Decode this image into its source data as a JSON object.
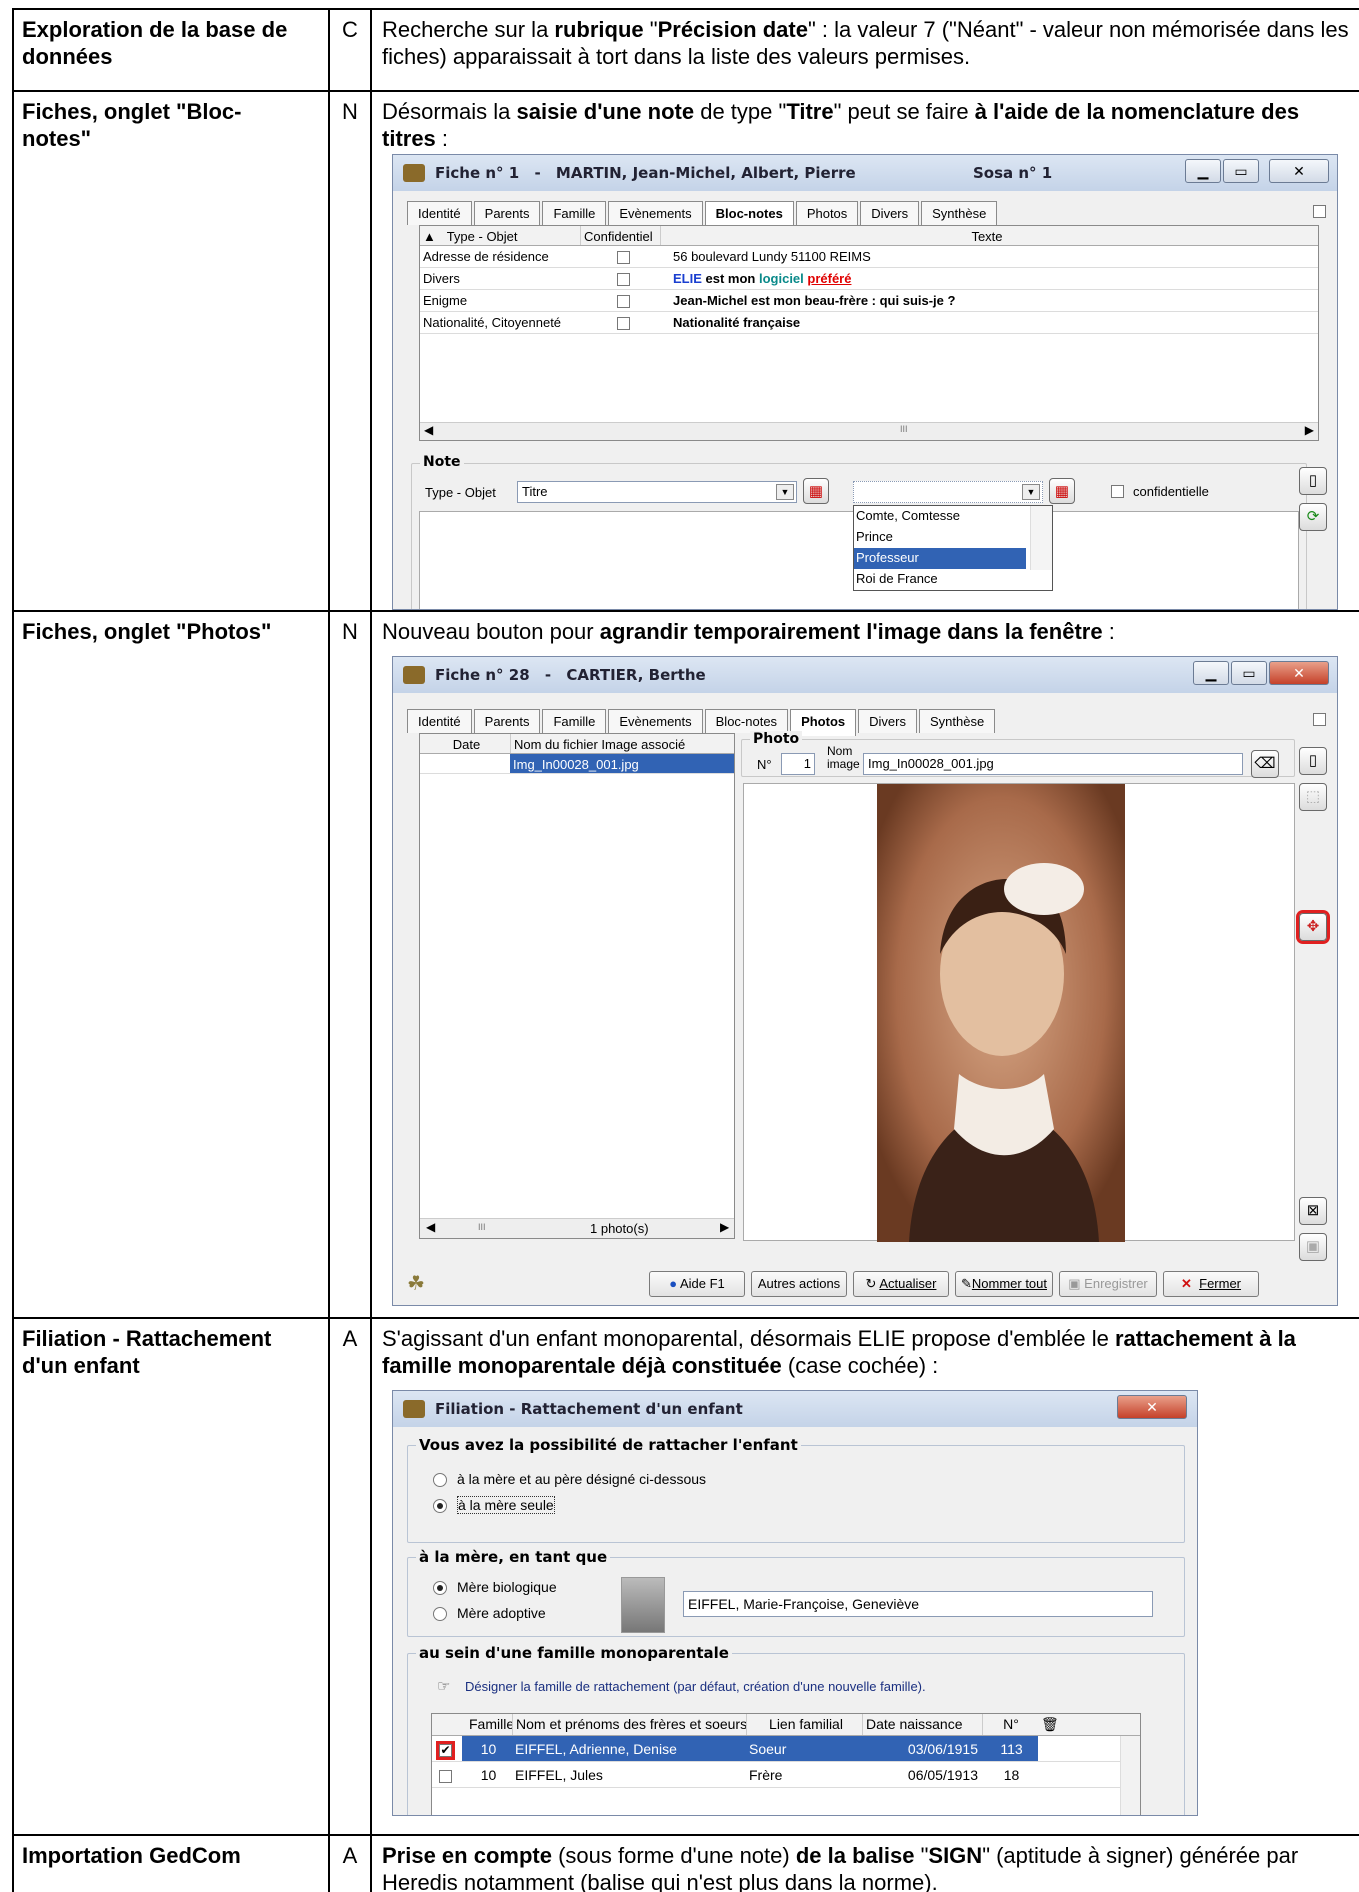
{
  "rows": [
    {
      "section": "Exploration de la base de données",
      "flag": "C",
      "text_parts": [
        {
          "t": "Recherche sur la ",
          "b": false
        },
        {
          "t": "rubrique",
          "b": true
        },
        {
          "t": " \"",
          "b": false
        },
        {
          "t": "Précision date",
          "b": true
        },
        {
          "t": "\" : la valeur 7 (\"Néant\" - valeur non mémorisée dans les fiches) apparaissait à tort dans la liste des valeurs permises.",
          "b": false
        }
      ]
    },
    {
      "section": "Fiches, onglet \"Bloc-notes\"",
      "flag": "N",
      "text_parts": [
        {
          "t": "Désormais la ",
          "b": false
        },
        {
          "t": "saisie d'une note",
          "b": true
        },
        {
          "t": " de type \"",
          "b": false
        },
        {
          "t": "Titre",
          "b": true
        },
        {
          "t": "\" peut se faire ",
          "b": false
        },
        {
          "t": "à l'aide de la nomenclature des titres",
          "b": true
        },
        {
          "t": " :",
          "b": false
        }
      ]
    },
    {
      "section": "Fiches, onglet \"Photos\"",
      "flag": "N",
      "text_parts": [
        {
          "t": "Nouveau bouton pour ",
          "b": false
        },
        {
          "t": "agrandir temporairement l'image dans la fenêtre",
          "b": true
        },
        {
          "t": " :",
          "b": false
        }
      ]
    },
    {
      "section": "Filiation - Rattachement d'un enfant",
      "flag": "A",
      "text_parts": [
        {
          "t": "S'agissant d'un enfant monoparental, désormais ELIE propose d'emblée le ",
          "b": false
        },
        {
          "t": "rattachement à la famille monoparentale déjà constituée",
          "b": true
        },
        {
          "t": " (case cochée) :",
          "b": false
        }
      ]
    },
    {
      "section": "Importation GedCom",
      "flag": "A",
      "text_parts": [
        {
          "t": "Prise en compte",
          "b": true
        },
        {
          "t": " (sous forme d'une note) ",
          "b": false
        },
        {
          "t": "de la balise",
          "b": true
        },
        {
          "t": " \"",
          "b": false
        },
        {
          "t": "SIGN",
          "b": true
        },
        {
          "t": "\" (aptitude à signer) générée par Heredis notamment (balise qui n'est plus dans la norme).",
          "b": false
        }
      ]
    }
  ],
  "bloc_notes_window": {
    "title_prefix": "Fiche n° 1",
    "title_name": "MARTIN, Jean-Michel, Albert, Pierre",
    "sosa": "Sosa n° 1",
    "tabs": [
      "Identité",
      "Parents",
      "Famille",
      "Evènements",
      "Bloc-notes",
      "Photos",
      "Divers",
      "Synthèse"
    ],
    "active_tab": "Bloc-notes",
    "columns": [
      "Type - Objet",
      "Confidentiel",
      "Texte"
    ],
    "notes": [
      {
        "type": "Adresse de résidence",
        "text": "56 boulevard Lundy  51100  REIMS"
      },
      {
        "type": "Divers",
        "text": "ELIE est mon logiciel préféré"
      },
      {
        "type": "Enigme",
        "text": "Jean-Michel est mon beau-frère : qui suis-je ?"
      },
      {
        "type": "Nationalité, Citoyenneté",
        "text": "Nationalité française"
      }
    ],
    "note_group": "Note",
    "type_label": "Type - Objet",
    "type_value": "Titre",
    "confidential_label": "confidentielle",
    "dropdown_options": [
      "Comte, Comtesse",
      "Prince",
      "Professeur",
      "Roi de France"
    ],
    "dropdown_selected": "Professeur",
    "scroll_mark": "III"
  },
  "photos_window": {
    "title_prefix": "Fiche n° 28",
    "title_name": "CARTIER, Berthe",
    "tabs": [
      "Identité",
      "Parents",
      "Famille",
      "Evènements",
      "Bloc-notes",
      "Photos",
      "Divers",
      "Synthèse"
    ],
    "active_tab": "Photos",
    "list_columns": [
      "Date",
      "Nom du fichier Image associé"
    ],
    "list_items": [
      "Img_In00028_001.jpg"
    ],
    "photo_group": "Photo",
    "num_label": "N°",
    "num_value": "1",
    "name_label_1": "Nom",
    "name_label_2": "image",
    "name_value": "Img_In00028_001.jpg",
    "count": "1 photo(s)",
    "scroll_mark": "III",
    "buttons": [
      "Aide  F1",
      "Autres actions",
      "Actualiser",
      "Nommer tout",
      "Enregistrer",
      "Fermer"
    ]
  },
  "filiation_window": {
    "title": "Filiation - Rattachement d'un enfant",
    "group1_title": "Vous avez la possibilité de rattacher l'enfant",
    "group1_options": [
      "à la mère et au père désigné ci-dessous",
      "à la mère seule"
    ],
    "group2_title": "à la mère, en tant que",
    "group2_options": [
      "Mère biologique",
      "Mère adoptive"
    ],
    "mother_name": "EIFFEL, Marie-Françoise, Geneviève",
    "group3_title": "au sein d'une famille monoparentale",
    "designate_text": "Désigner la famille de rattachement (par défaut, création d'une nouvelle famille).",
    "columns": [
      "Famille",
      "Nom et prénoms des frères et soeurs",
      "Lien familial",
      "Date naissance",
      "N°"
    ],
    "rows": [
      {
        "famille": "10",
        "nom": "EIFFEL, Adrienne, Denise",
        "lien": "Soeur",
        "date": "03/06/1915",
        "num": "113",
        "checked": true
      },
      {
        "famille": "10",
        "nom": "EIFFEL, Jules",
        "lien": "Frère",
        "date": "06/05/1913",
        "num": "18",
        "checked": false
      }
    ]
  },
  "colors": {
    "selection": "#3163b4",
    "highlight_ring": "#e02020",
    "accent_blue": "#1a3fd0",
    "accent_teal": "#0a8a8a",
    "accent_red": "#e00000"
  }
}
